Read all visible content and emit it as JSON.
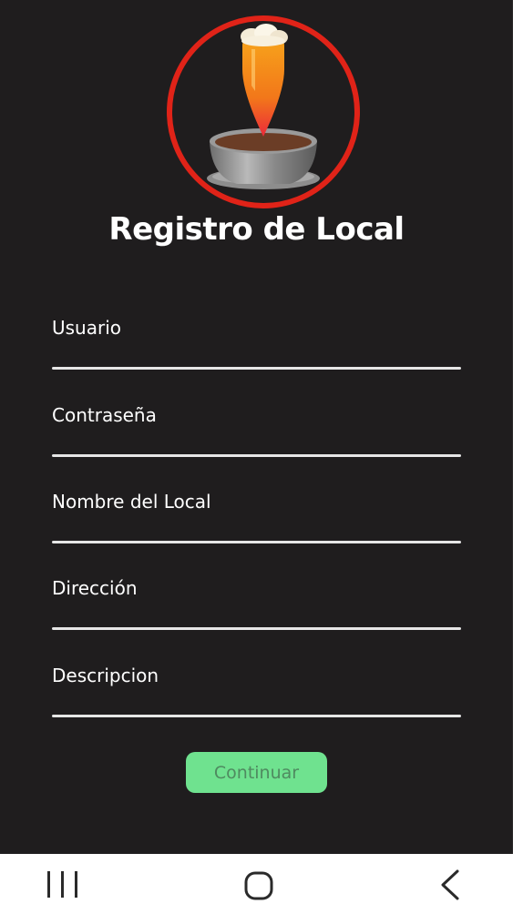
{
  "title": "Registro de Local",
  "fields": [
    {
      "label": "Usuario"
    },
    {
      "label": "Contraseña"
    },
    {
      "label": "Nombre del Local"
    },
    {
      "label": "Dirección"
    },
    {
      "label": "Descripcion"
    }
  ],
  "button": {
    "label": "Continuar"
  },
  "colors": {
    "background": "#1f1d1e",
    "button": "#6fe28f",
    "button_text": "#4f8a60",
    "logo_ring": "#e02318"
  },
  "icons": {
    "logo": "beer-cup-location-logo",
    "nav_recent": "recent-apps-icon",
    "nav_home": "home-icon",
    "nav_back": "back-icon"
  }
}
